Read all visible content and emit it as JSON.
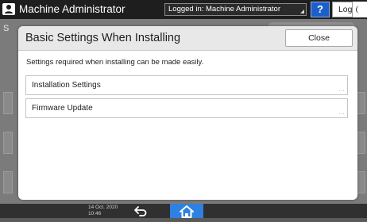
{
  "header": {
    "title": "Machine Administrator",
    "login_status": "Logged in: Machine Administrator",
    "help_label": "?",
    "logout_label": "Logout"
  },
  "background": {
    "initial": "S"
  },
  "dialog": {
    "title": "Basic Settings When Installing",
    "close_label": "Close",
    "description": "Settings required when installing can be made easily.",
    "items": [
      {
        "label": "Installation Settings",
        "more": "..."
      },
      {
        "label": "Firmware Update",
        "more": "..."
      }
    ]
  },
  "footer": {
    "date": "14 Oct. 2020",
    "time": "10:46"
  },
  "colors": {
    "topbar": "#1e1e1e",
    "help_button": "#1d5fc9",
    "home_button": "#2f80e0",
    "dialog_header": "#e8e8e8"
  },
  "icons": {
    "user": "user-icon",
    "moon": "moon-icon",
    "back": "back-arrow-icon",
    "home": "home-icon"
  }
}
